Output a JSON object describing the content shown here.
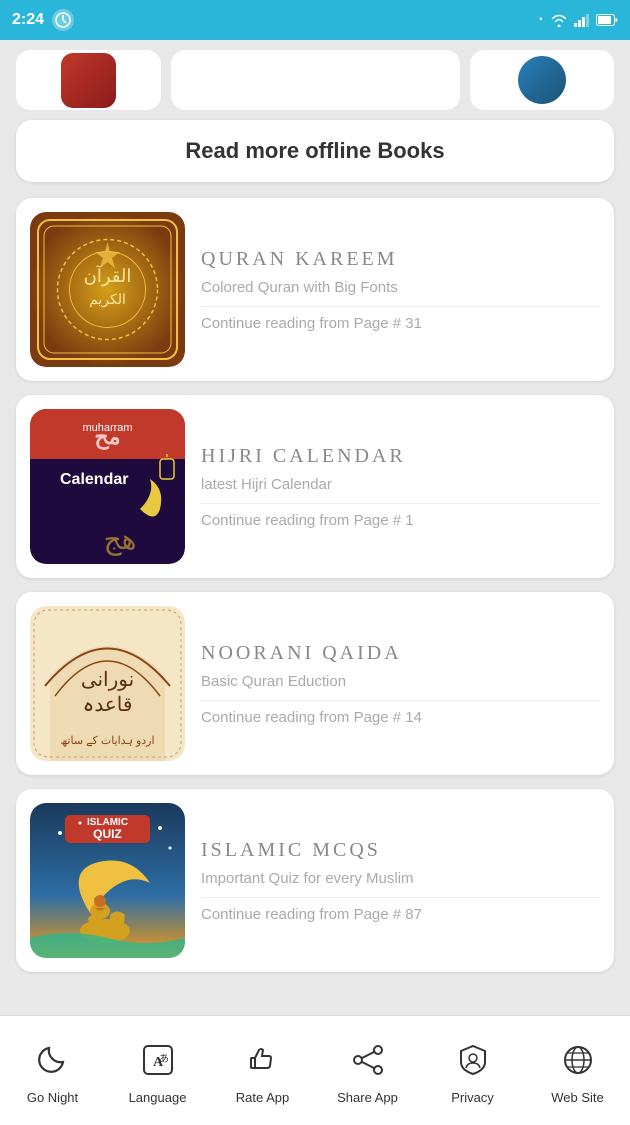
{
  "statusBar": {
    "time": "2:24",
    "signal": "·",
    "wifi": "wifi",
    "battery": "battery"
  },
  "readMoreButton": {
    "label": "Read more offline Books"
  },
  "books": [
    {
      "id": "quran-kareem",
      "title": "Quran  Kareem",
      "subtitle": "Colored Quran with Big Fonts",
      "progress": "Continue reading from Page # 31",
      "bgColor1": "#8B4513",
      "bgColor2": "#D4A017"
    },
    {
      "id": "hijri-calendar",
      "title": "Hijri  Calendar",
      "subtitle": "latest Hijri Calendar",
      "progress": "Continue reading from Page # 1",
      "bgColor1": "#2c1654",
      "bgColor2": "#e74c3c"
    },
    {
      "id": "noorani-qaida",
      "title": "Noorani  Qaida",
      "subtitle": "Basic Quran Eduction",
      "progress": "Continue reading from Page # 14",
      "bgColor1": "#f5deb3",
      "bgColor2": "#8B4513"
    },
    {
      "id": "islamic-mcqs",
      "title": "Islamic  Mcqs",
      "subtitle": "Important Quiz for every Muslim",
      "progress": "Continue reading from Page # 87",
      "bgColor1": "#1a3a5c",
      "bgColor2": "#f39c12"
    }
  ],
  "bottomNav": [
    {
      "id": "go-night",
      "label": "Go Night",
      "icon": "night"
    },
    {
      "id": "language",
      "label": "Language",
      "icon": "language"
    },
    {
      "id": "rate-app",
      "label": "Rate App",
      "icon": "rate"
    },
    {
      "id": "share-app",
      "label": "Share App",
      "icon": "share"
    },
    {
      "id": "privacy",
      "label": "Privacy",
      "icon": "privacy"
    },
    {
      "id": "web-site",
      "label": "Web Site",
      "icon": "web"
    }
  ]
}
